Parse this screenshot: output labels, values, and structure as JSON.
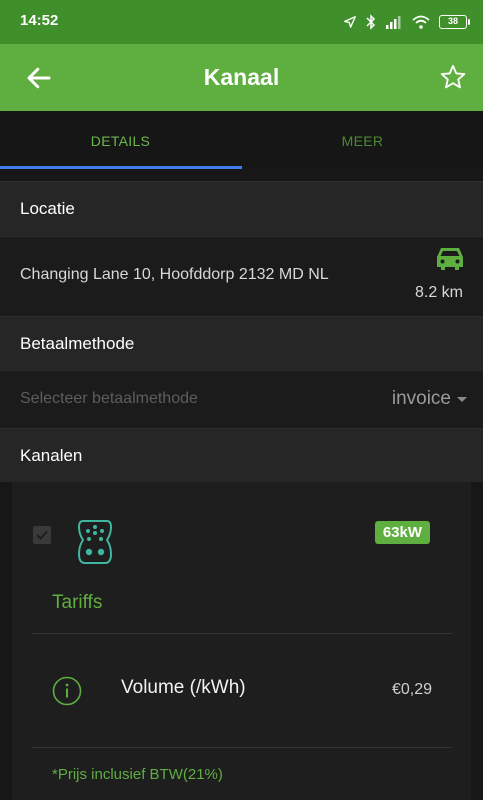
{
  "status_bar": {
    "time": "14:52",
    "battery": "38",
    "icons": [
      "location-arrow-icon",
      "bluetooth-icon",
      "signal-icon",
      "wifi-icon",
      "battery-icon"
    ]
  },
  "app_bar": {
    "title": "Kanaal",
    "back_icon": "arrow-left-icon",
    "favorite_icon": "star-outline-icon"
  },
  "tabs": [
    {
      "label": "DETAILS",
      "active": true
    },
    {
      "label": "MEER",
      "active": false
    }
  ],
  "location": {
    "header": "Locatie",
    "address": "Changing Lane 10, Hoofddorp 2132 MD NL",
    "distance": "8.2 km",
    "icon": "car-icon"
  },
  "payment": {
    "header": "Betaalmethode",
    "placeholder": "Selecteer betaalmethode",
    "selected": "invoice"
  },
  "channels": {
    "header": "Kanalen",
    "power": "63kW",
    "connector_icon": "ev-connector-icon",
    "tariffs_title": "Tariffs",
    "tariffs": [
      {
        "label": "Volume (/kWh)",
        "price": "€0,29"
      }
    ],
    "vat_note": "*Prijs inclusief BTW(21%)"
  },
  "colors": {
    "status_bar": "#3f8f2a",
    "app_bar": "#5fae40",
    "accent_green": "#5fae40",
    "tab_indicator": "#3f7df0",
    "background": "#171717"
  }
}
